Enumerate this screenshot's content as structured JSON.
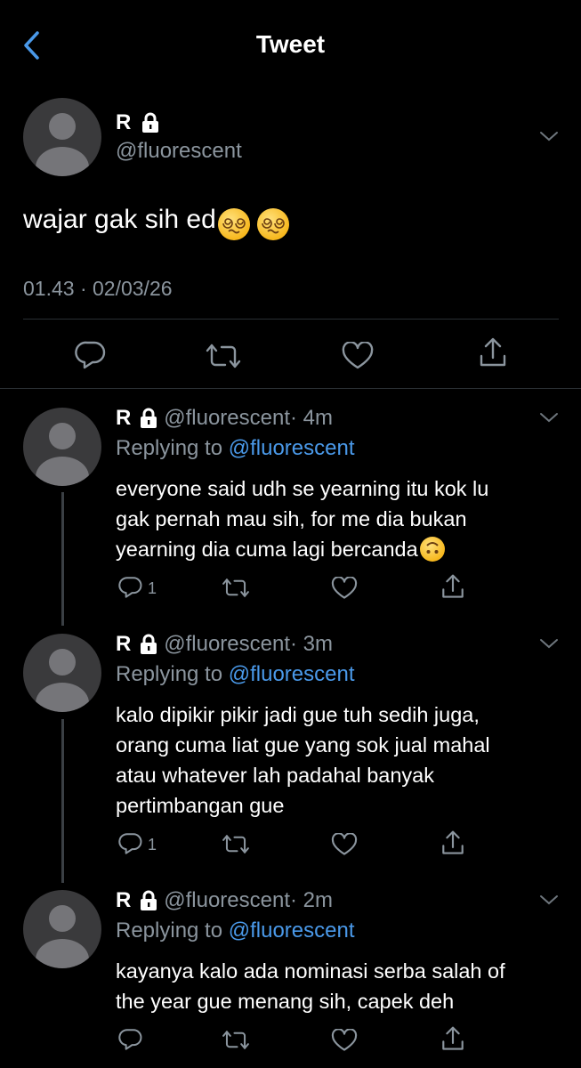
{
  "header": {
    "title": "Tweet"
  },
  "main_tweet": {
    "name": "R",
    "handle": "@fluorescent",
    "text": "wajar gak sih ed",
    "timestamp": "01.43 · 02/03/26"
  },
  "replies": [
    {
      "name": "R",
      "handle": "@fluorescent",
      "time": "· 4m",
      "replying_label": "Replying to",
      "replying_handle": "@fluorescent",
      "lines": [
        "everyone said udh se yearning itu kok lu",
        "gak pernah mau sih, for me dia bukan",
        "yearning dia cuma lagi bercanda"
      ],
      "reply_count": "1"
    },
    {
      "name": "R",
      "handle": "@fluorescent",
      "time": "· 3m",
      "replying_label": "Replying to",
      "replying_handle": "@fluorescent",
      "lines": [
        "kalo dipikir pikir jadi gue tuh sedih juga,",
        "orang cuma liat gue yang sok jual mahal",
        "atau whatever lah padahal banyak",
        "pertimbangan gue"
      ],
      "reply_count": "1"
    },
    {
      "name": "R",
      "handle": "@fluorescent",
      "time": "· 2m",
      "replying_label": "Replying to",
      "replying_handle": "@fluorescent",
      "lines": [
        "kayanya kalo ada nominasi serba salah of",
        "the year gue menang sih, capek deh"
      ],
      "reply_count": ""
    }
  ],
  "colors": {
    "background": "#000000",
    "accent": "#4a99e9",
    "muted": "#8b959e"
  },
  "icons": [
    "back-chevron-icon",
    "lock-icon",
    "chevron-down-icon",
    "reply-icon",
    "retweet-icon",
    "like-icon",
    "share-icon",
    "dizzy-face-emoji",
    "upside-down-face-emoji"
  ]
}
